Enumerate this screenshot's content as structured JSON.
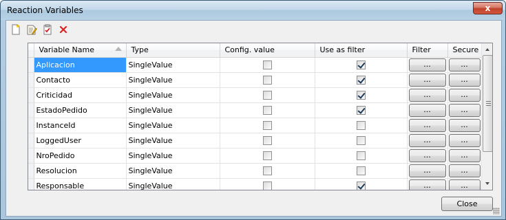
{
  "window": {
    "title": "Reaction Variables",
    "close_glyph": "x"
  },
  "toolbar": {
    "buttons": [
      {
        "icon": "new-document-icon"
      },
      {
        "icon": "edit-document-icon"
      },
      {
        "icon": "validate-icon"
      },
      {
        "icon": "delete-icon",
        "color": "#e02020"
      }
    ]
  },
  "grid": {
    "columns": [
      "Variable Name",
      "Type",
      "Config. value",
      "Use as filter",
      "Filter",
      "Secure"
    ],
    "sort_column": "Variable Name",
    "selection_color": "#3399ff",
    "rows": [
      {
        "name": "Aplicacion",
        "type": "SingleValue",
        "config": false,
        "filter_use": true,
        "filter_btn": "...",
        "secure_btn": "...",
        "selected": true
      },
      {
        "name": "Contacto",
        "type": "SingleValue",
        "config": false,
        "filter_use": true,
        "filter_btn": "...",
        "secure_btn": "..."
      },
      {
        "name": "Criticidad",
        "type": "SingleValue",
        "config": false,
        "filter_use": true,
        "filter_btn": "...",
        "secure_btn": "..."
      },
      {
        "name": "EstadoPedido",
        "type": "SingleValue",
        "config": false,
        "filter_use": true,
        "filter_btn": "...",
        "secure_btn": "..."
      },
      {
        "name": "InstanceId",
        "type": "SingleValue",
        "config": false,
        "filter_use": false,
        "filter_btn": "...",
        "secure_btn": "..."
      },
      {
        "name": "LoggedUser",
        "type": "SingleValue",
        "config": false,
        "filter_use": false,
        "filter_btn": "...",
        "secure_btn": "..."
      },
      {
        "name": "NroPedido",
        "type": "SingleValue",
        "config": false,
        "filter_use": false,
        "filter_btn": "...",
        "secure_btn": "..."
      },
      {
        "name": "Resolucion",
        "type": "SingleValue",
        "config": false,
        "filter_use": false,
        "filter_btn": "...",
        "secure_btn": "..."
      },
      {
        "name": "Responsable",
        "type": "SingleValue",
        "config": false,
        "filter_use": true,
        "filter_btn": "...",
        "secure_btn": "..."
      }
    ]
  },
  "footer": {
    "close_label": "Close"
  }
}
